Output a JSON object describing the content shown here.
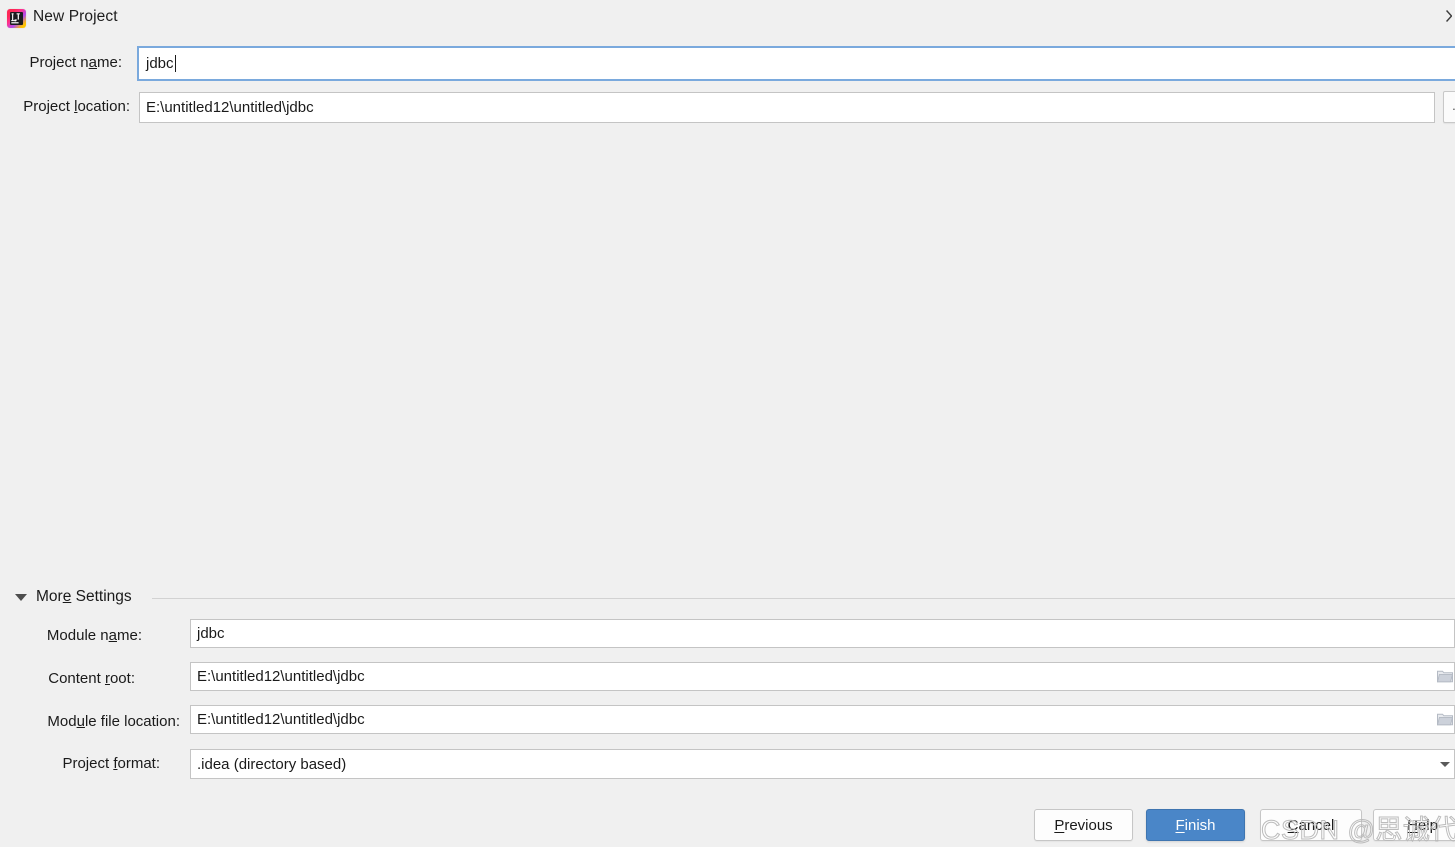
{
  "window": {
    "title": "New Project",
    "app_icon": "intellij-idea-logo",
    "close_icon": "close-x-icon"
  },
  "top_form": {
    "project_name": {
      "label_before": "Project n",
      "label_mnemonic": "a",
      "label_after": "me:",
      "label_full": "Project name:",
      "value": "jdbc",
      "focused": true
    },
    "project_location": {
      "label_before": "Project ",
      "label_mnemonic": "l",
      "label_after": "ocation:",
      "label_full": "Project location:",
      "value": "E:\\untitled12\\untitled\\jdbc",
      "browse_label": "..."
    }
  },
  "more_settings": {
    "label_before": "Mor",
    "label_mnemonic": "e",
    "label_after": " Settings",
    "label_full": "More Settings",
    "expanded": true,
    "disclosure_icon": "triangle-down-icon",
    "fields": [
      {
        "name": "module-name",
        "label_before": "Module n",
        "label_mnemonic": "a",
        "label_after": "me:",
        "label_full": "Module name:",
        "value": "jdbc",
        "trailing_icon": "none"
      },
      {
        "name": "content-root",
        "label_before": "Content ",
        "label_mnemonic": "r",
        "label_after": "oot:",
        "label_full": "Content root:",
        "value": "E:\\untitled12\\untitled\\jdbc",
        "trailing_icon": "folder-icon"
      },
      {
        "name": "module-file-location",
        "label_before": "Mod",
        "label_mnemonic": "u",
        "label_after": "le file location:",
        "label_full": "Module file location:",
        "value": "E:\\untitled12\\untitled\\jdbc",
        "trailing_icon": "folder-icon"
      },
      {
        "name": "project-format",
        "label_before": "Project ",
        "label_mnemonic": "f",
        "label_after": "ormat:",
        "label_full": "Project format:",
        "value": ".idea (directory based)",
        "trailing_icon": "chevron-down-icon",
        "options": [
          ".idea (directory based)"
        ]
      }
    ]
  },
  "buttons": {
    "previous": {
      "before": "",
      "mnemonic": "P",
      "after": "revious",
      "full": "Previous"
    },
    "finish": {
      "before": "",
      "mnemonic": "F",
      "after": "inish",
      "full": "Finish",
      "primary": true
    },
    "cancel": {
      "before": "",
      "mnemonic": "C",
      "after": "ancel",
      "full": "Cancel"
    },
    "help": {
      "before": "",
      "mnemonic": "H",
      "after": "elp",
      "full": "Help"
    }
  },
  "watermark": {
    "text": "CSDN @思诚代码块"
  },
  "colors": {
    "dialog_background": "#f0f0f0",
    "field_background": "#ffffff",
    "field_border": "#c4c4c4",
    "focus_ring": "#7aa9dd",
    "primary_button": "#4a86c8",
    "text": "#1a1a1a",
    "separator": "#d2d2d2",
    "watermark": "#b9b9b9"
  }
}
